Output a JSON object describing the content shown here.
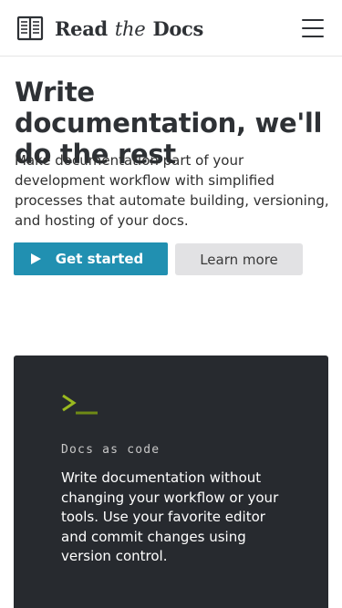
{
  "header": {
    "logo": {
      "read": "Read",
      "the": "the",
      "docs": "Docs",
      "icon": "book-icon"
    },
    "menu_icon": "hamburger-menu-icon"
  },
  "hero": {
    "title": "Write documentation, we'll do the rest",
    "subtitle": "Make documentation part of your development workflow with simplified processes that automate building, versioning, and hosting of your docs.",
    "primary_button": {
      "label": "Get started",
      "icon": "play-icon",
      "color": "#2190b1"
    },
    "secondary_button": {
      "label": "Learn more",
      "color": "#e2e2e4"
    }
  },
  "feature_card": {
    "icon": "terminal-prompt-icon",
    "label": "Docs as code",
    "body": "Write documentation without changing your workflow or your tools. Use your favorite editor and commit changes using version control.",
    "background": "#272a2f",
    "accent": "#9ab91f"
  }
}
